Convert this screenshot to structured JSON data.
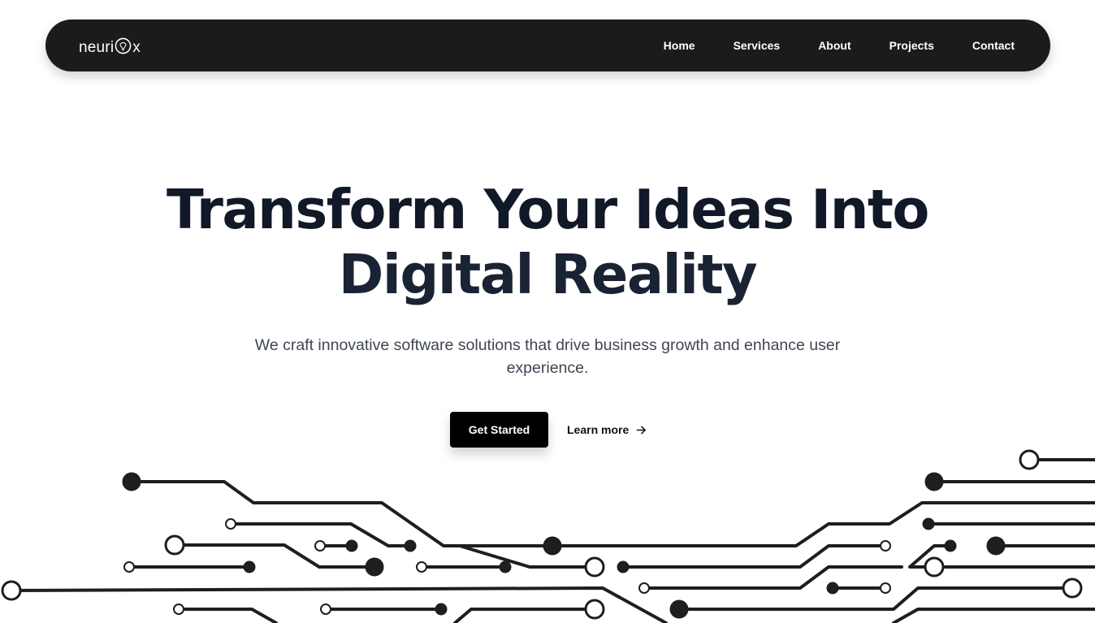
{
  "brand": {
    "logo_text_left": "neuri",
    "logo_text_right": "x"
  },
  "nav": {
    "links": [
      "Home",
      "Services",
      "About",
      "Projects",
      "Contact"
    ]
  },
  "hero": {
    "title_line1": "Transform Your Ideas Into",
    "title_line2": "Digital Reality",
    "subtitle": "We craft innovative software solutions that drive business growth and enhance user experience.",
    "primary_cta": "Get Started",
    "secondary_cta": "Learn more"
  },
  "icons": {
    "logo_mark": "brain-bulb-icon",
    "learn_more_arrow": "arrow-right-icon",
    "decoration": "circuit-board-illustration"
  },
  "colors": {
    "nav_bg": "#1b1b1b",
    "title": "#111827",
    "subtitle": "#3f4654",
    "button_bg": "#000000",
    "circuit": "#1e1e1e"
  }
}
